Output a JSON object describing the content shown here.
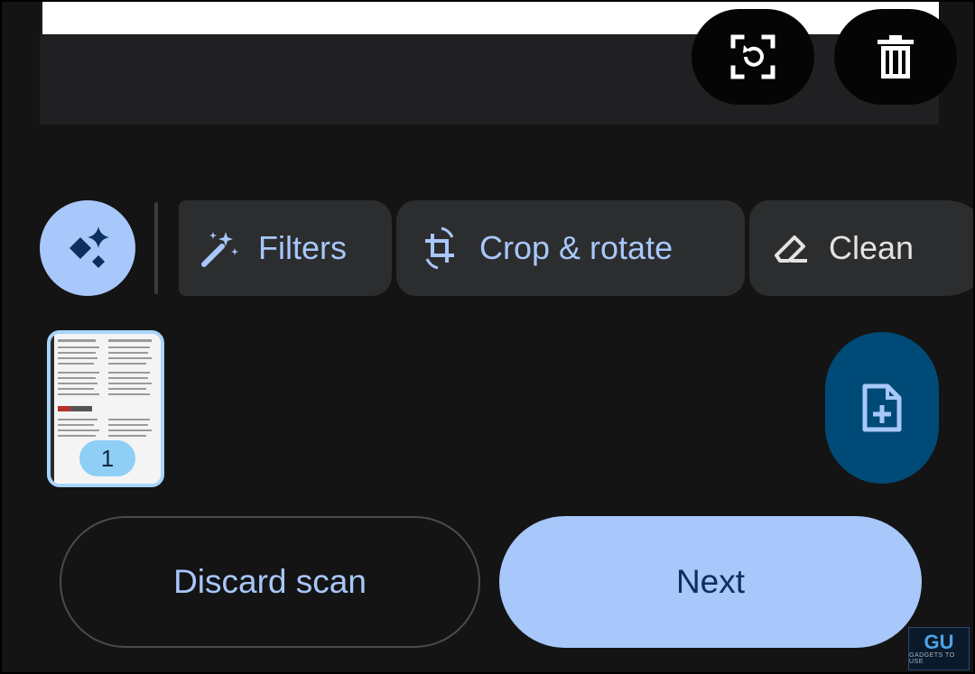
{
  "preview": {
    "rescan_icon": "rotate-in-frame-icon",
    "delete_icon": "trash-icon"
  },
  "toolbar": {
    "enhance_icon": "sparkle-diamond-icon",
    "chips": [
      {
        "label": "Filters",
        "icon": "magic-wand-icon"
      },
      {
        "label": "Crop & rotate",
        "icon": "crop-rotate-icon"
      },
      {
        "label": "Clean",
        "icon": "eraser-icon"
      }
    ]
  },
  "pages": {
    "thumbnail_badge": "1",
    "add_page_icon": "add-document-icon"
  },
  "actions": {
    "discard_label": "Discard scan",
    "next_label": "Next"
  },
  "watermark": {
    "mark": "GU",
    "text": "GADGETS TO USE"
  },
  "colors": {
    "background": "#141414",
    "accent": "#a8c7fa",
    "chip_background": "#2c2d2f",
    "add_button": "#004a77",
    "thumb_border": "#a8d4fa"
  }
}
